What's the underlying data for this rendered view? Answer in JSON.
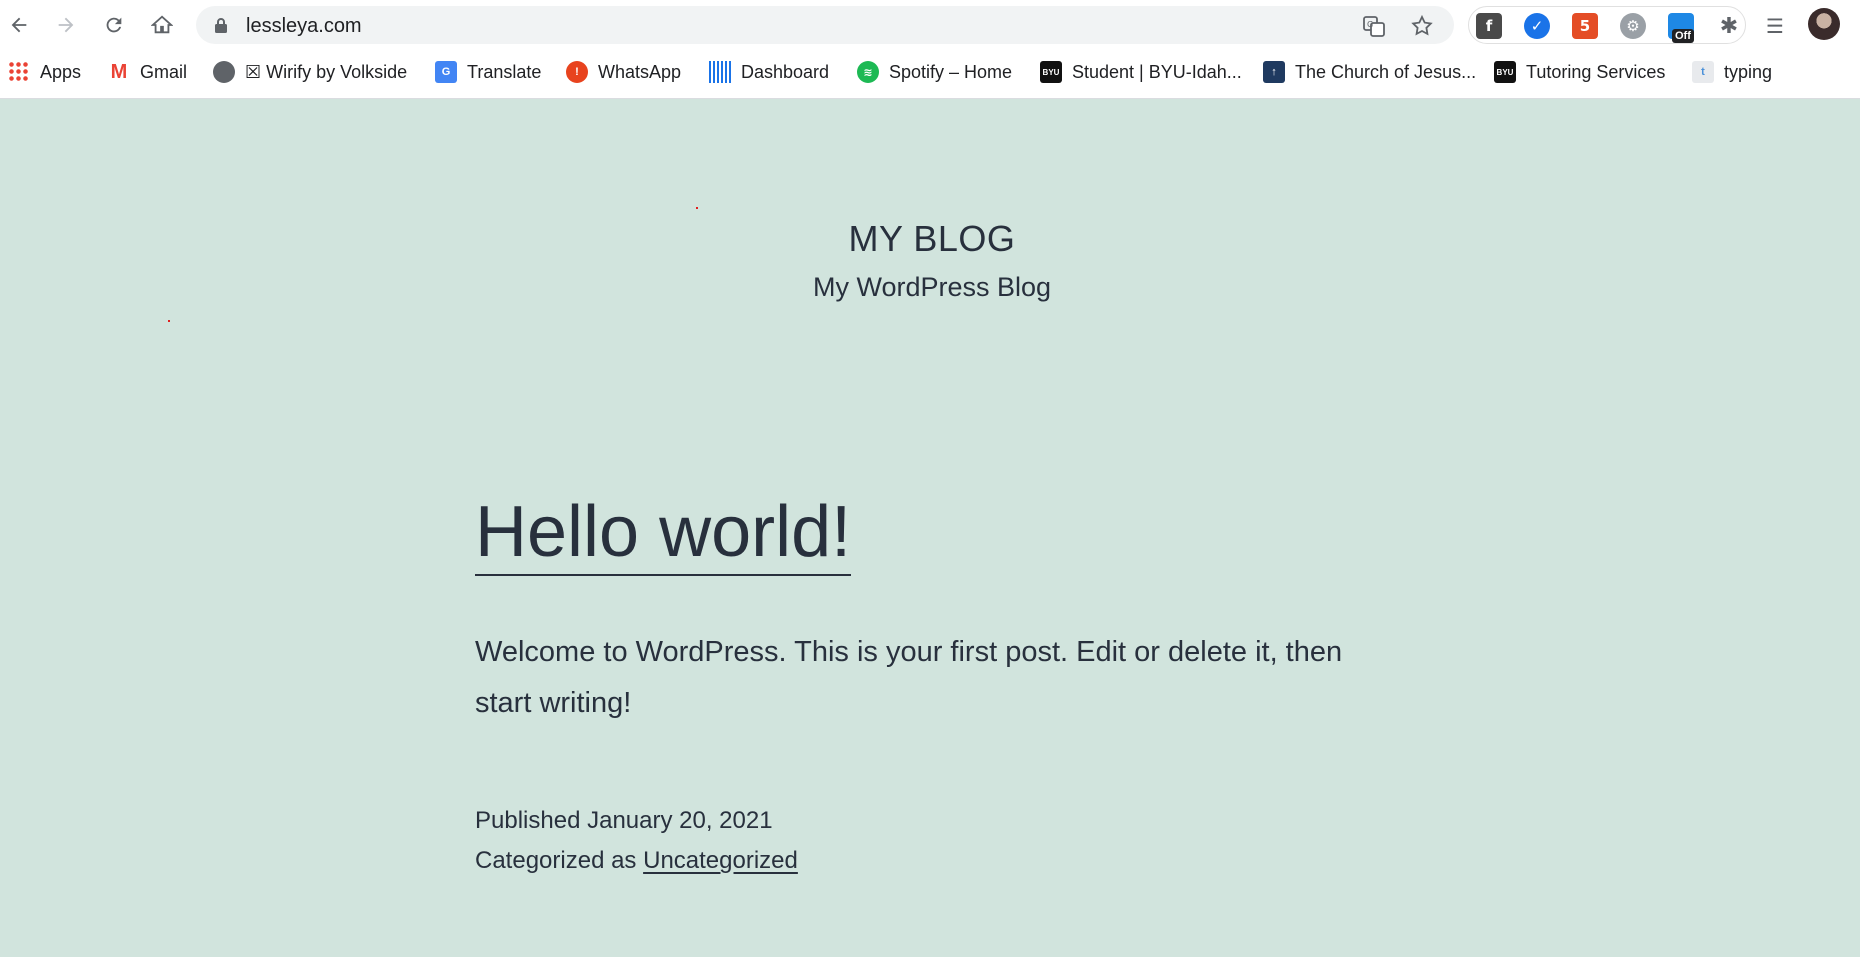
{
  "browser": {
    "url": "lessleya.com",
    "extension_badge": "Off"
  },
  "bookmarks": [
    {
      "label": "Apps",
      "icon": "apps-grid-icon"
    },
    {
      "label": "Gmail",
      "icon": "gmail-icon"
    },
    {
      "label": "☒ Wirify by Volkside",
      "icon": "globe-icon"
    },
    {
      "label": "Translate",
      "icon": "translate-icon"
    },
    {
      "label": "WhatsApp",
      "icon": "whatsapp-icon"
    },
    {
      "label": "Dashboard",
      "icon": "dashboard-bars-icon"
    },
    {
      "label": "Spotify – Home",
      "icon": "spotify-icon"
    },
    {
      "label": "Student | BYU-Idah...",
      "icon": "byu-icon"
    },
    {
      "label": "The Church of Jesus...",
      "icon": "church-icon"
    },
    {
      "label": "Tutoring Services",
      "icon": "byu-icon"
    },
    {
      "label": "typing",
      "icon": "typing-icon"
    }
  ],
  "site": {
    "title": "MY BLOG",
    "description": "My WordPress Blog"
  },
  "post": {
    "title": "Hello world!",
    "body": "Welcome to WordPress. This is your first post. Edit or delete it, then start writing!",
    "published_label": "Published",
    "published_date": "January 20, 2021",
    "categorized_label": "Categorized as",
    "category": "Uncategorized"
  },
  "colors": {
    "page_background": "#d1e4dd",
    "text": "#28303d"
  }
}
